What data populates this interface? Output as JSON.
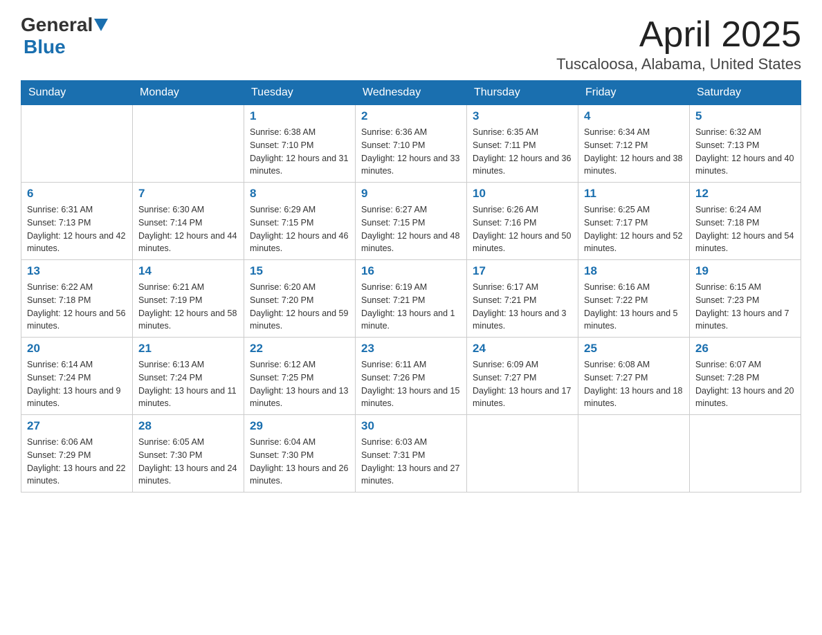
{
  "header": {
    "logo_general": "General",
    "logo_blue": "Blue",
    "title": "April 2025",
    "subtitle": "Tuscaloosa, Alabama, United States"
  },
  "days_of_week": [
    "Sunday",
    "Monday",
    "Tuesday",
    "Wednesday",
    "Thursday",
    "Friday",
    "Saturday"
  ],
  "weeks": [
    [
      {
        "day": "",
        "sunrise": "",
        "sunset": "",
        "daylight": ""
      },
      {
        "day": "",
        "sunrise": "",
        "sunset": "",
        "daylight": ""
      },
      {
        "day": "1",
        "sunrise": "Sunrise: 6:38 AM",
        "sunset": "Sunset: 7:10 PM",
        "daylight": "Daylight: 12 hours and 31 minutes."
      },
      {
        "day": "2",
        "sunrise": "Sunrise: 6:36 AM",
        "sunset": "Sunset: 7:10 PM",
        "daylight": "Daylight: 12 hours and 33 minutes."
      },
      {
        "day": "3",
        "sunrise": "Sunrise: 6:35 AM",
        "sunset": "Sunset: 7:11 PM",
        "daylight": "Daylight: 12 hours and 36 minutes."
      },
      {
        "day": "4",
        "sunrise": "Sunrise: 6:34 AM",
        "sunset": "Sunset: 7:12 PM",
        "daylight": "Daylight: 12 hours and 38 minutes."
      },
      {
        "day": "5",
        "sunrise": "Sunrise: 6:32 AM",
        "sunset": "Sunset: 7:13 PM",
        "daylight": "Daylight: 12 hours and 40 minutes."
      }
    ],
    [
      {
        "day": "6",
        "sunrise": "Sunrise: 6:31 AM",
        "sunset": "Sunset: 7:13 PM",
        "daylight": "Daylight: 12 hours and 42 minutes."
      },
      {
        "day": "7",
        "sunrise": "Sunrise: 6:30 AM",
        "sunset": "Sunset: 7:14 PM",
        "daylight": "Daylight: 12 hours and 44 minutes."
      },
      {
        "day": "8",
        "sunrise": "Sunrise: 6:29 AM",
        "sunset": "Sunset: 7:15 PM",
        "daylight": "Daylight: 12 hours and 46 minutes."
      },
      {
        "day": "9",
        "sunrise": "Sunrise: 6:27 AM",
        "sunset": "Sunset: 7:15 PM",
        "daylight": "Daylight: 12 hours and 48 minutes."
      },
      {
        "day": "10",
        "sunrise": "Sunrise: 6:26 AM",
        "sunset": "Sunset: 7:16 PM",
        "daylight": "Daylight: 12 hours and 50 minutes."
      },
      {
        "day": "11",
        "sunrise": "Sunrise: 6:25 AM",
        "sunset": "Sunset: 7:17 PM",
        "daylight": "Daylight: 12 hours and 52 minutes."
      },
      {
        "day": "12",
        "sunrise": "Sunrise: 6:24 AM",
        "sunset": "Sunset: 7:18 PM",
        "daylight": "Daylight: 12 hours and 54 minutes."
      }
    ],
    [
      {
        "day": "13",
        "sunrise": "Sunrise: 6:22 AM",
        "sunset": "Sunset: 7:18 PM",
        "daylight": "Daylight: 12 hours and 56 minutes."
      },
      {
        "day": "14",
        "sunrise": "Sunrise: 6:21 AM",
        "sunset": "Sunset: 7:19 PM",
        "daylight": "Daylight: 12 hours and 58 minutes."
      },
      {
        "day": "15",
        "sunrise": "Sunrise: 6:20 AM",
        "sunset": "Sunset: 7:20 PM",
        "daylight": "Daylight: 12 hours and 59 minutes."
      },
      {
        "day": "16",
        "sunrise": "Sunrise: 6:19 AM",
        "sunset": "Sunset: 7:21 PM",
        "daylight": "Daylight: 13 hours and 1 minute."
      },
      {
        "day": "17",
        "sunrise": "Sunrise: 6:17 AM",
        "sunset": "Sunset: 7:21 PM",
        "daylight": "Daylight: 13 hours and 3 minutes."
      },
      {
        "day": "18",
        "sunrise": "Sunrise: 6:16 AM",
        "sunset": "Sunset: 7:22 PM",
        "daylight": "Daylight: 13 hours and 5 minutes."
      },
      {
        "day": "19",
        "sunrise": "Sunrise: 6:15 AM",
        "sunset": "Sunset: 7:23 PM",
        "daylight": "Daylight: 13 hours and 7 minutes."
      }
    ],
    [
      {
        "day": "20",
        "sunrise": "Sunrise: 6:14 AM",
        "sunset": "Sunset: 7:24 PM",
        "daylight": "Daylight: 13 hours and 9 minutes."
      },
      {
        "day": "21",
        "sunrise": "Sunrise: 6:13 AM",
        "sunset": "Sunset: 7:24 PM",
        "daylight": "Daylight: 13 hours and 11 minutes."
      },
      {
        "day": "22",
        "sunrise": "Sunrise: 6:12 AM",
        "sunset": "Sunset: 7:25 PM",
        "daylight": "Daylight: 13 hours and 13 minutes."
      },
      {
        "day": "23",
        "sunrise": "Sunrise: 6:11 AM",
        "sunset": "Sunset: 7:26 PM",
        "daylight": "Daylight: 13 hours and 15 minutes."
      },
      {
        "day": "24",
        "sunrise": "Sunrise: 6:09 AM",
        "sunset": "Sunset: 7:27 PM",
        "daylight": "Daylight: 13 hours and 17 minutes."
      },
      {
        "day": "25",
        "sunrise": "Sunrise: 6:08 AM",
        "sunset": "Sunset: 7:27 PM",
        "daylight": "Daylight: 13 hours and 18 minutes."
      },
      {
        "day": "26",
        "sunrise": "Sunrise: 6:07 AM",
        "sunset": "Sunset: 7:28 PM",
        "daylight": "Daylight: 13 hours and 20 minutes."
      }
    ],
    [
      {
        "day": "27",
        "sunrise": "Sunrise: 6:06 AM",
        "sunset": "Sunset: 7:29 PM",
        "daylight": "Daylight: 13 hours and 22 minutes."
      },
      {
        "day": "28",
        "sunrise": "Sunrise: 6:05 AM",
        "sunset": "Sunset: 7:30 PM",
        "daylight": "Daylight: 13 hours and 24 minutes."
      },
      {
        "day": "29",
        "sunrise": "Sunrise: 6:04 AM",
        "sunset": "Sunset: 7:30 PM",
        "daylight": "Daylight: 13 hours and 26 minutes."
      },
      {
        "day": "30",
        "sunrise": "Sunrise: 6:03 AM",
        "sunset": "Sunset: 7:31 PM",
        "daylight": "Daylight: 13 hours and 27 minutes."
      },
      {
        "day": "",
        "sunrise": "",
        "sunset": "",
        "daylight": ""
      },
      {
        "day": "",
        "sunrise": "",
        "sunset": "",
        "daylight": ""
      },
      {
        "day": "",
        "sunrise": "",
        "sunset": "",
        "daylight": ""
      }
    ]
  ]
}
